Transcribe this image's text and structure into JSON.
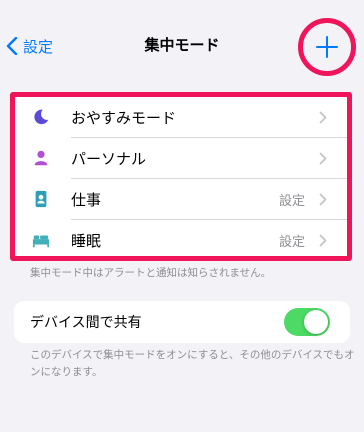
{
  "nav": {
    "back_label": "設定",
    "title": "集中モード",
    "add_icon": "plus-icon"
  },
  "focus_modes": [
    {
      "label": "おやすみモード",
      "value": "",
      "icon": "moon-icon",
      "icon_color": "#5b4bd6"
    },
    {
      "label": "パーソナル",
      "value": "",
      "icon": "person-icon",
      "icon_color": "#b34fd3"
    },
    {
      "label": "仕事",
      "value": "設定",
      "icon": "id-badge-icon",
      "icon_color": "#2f9fb3"
    },
    {
      "label": "睡眠",
      "value": "設定",
      "icon": "bed-icon",
      "icon_color": "#3fb0b8"
    }
  ],
  "focus_footer": "集中モード中はアラートと通知は知らされません。",
  "share": {
    "label": "デバイス間で共有",
    "enabled": true
  },
  "share_footer": "このデバイスで集中モードをオンにすると、その他のデバイスでもオンになります。",
  "colors": {
    "accent": "#007aff",
    "highlight": "#f0145a",
    "toggle_on": "#4cd964",
    "secondary_text": "#8e8e93"
  }
}
